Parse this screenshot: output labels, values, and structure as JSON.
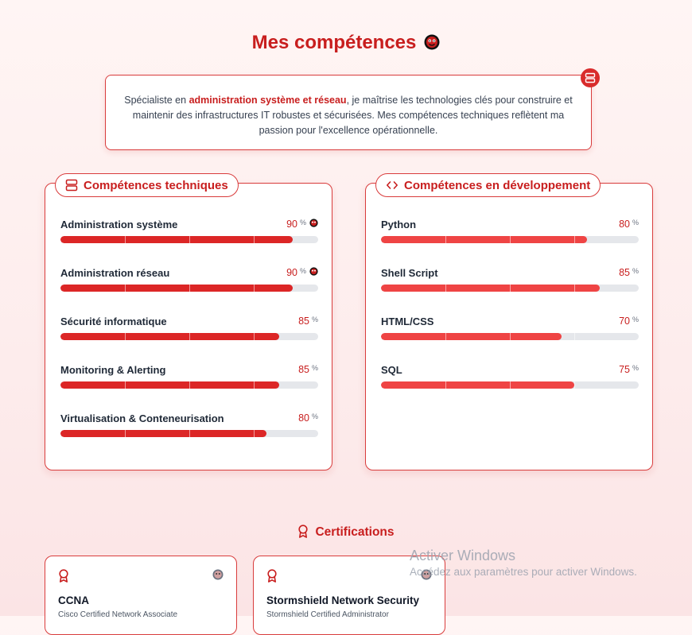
{
  "header": {
    "title": "Mes compétences",
    "emoji_icon": "smiley-icon"
  },
  "intro": {
    "text_before": "Spécialiste en ",
    "highlight": "administration système et réseau",
    "text_after": ", je maîtrise les technologies clés pour construire et maintenir des infrastructures IT robustes et sécurisées. Mes compétences techniques reflètent ma passion pour l'excellence opérationnelle.",
    "badge_icon": "server-icon"
  },
  "technical": {
    "title": "Compétences techniques",
    "icon": "server-icon",
    "skills": [
      {
        "name": "Administration système",
        "value": 90,
        "unit": "%",
        "emoji": true
      },
      {
        "name": "Administration réseau",
        "value": 90,
        "unit": "%",
        "emoji": true
      },
      {
        "name": "Sécurité informatique",
        "value": 85,
        "unit": "%",
        "emoji": false
      },
      {
        "name": "Monitoring & Alerting",
        "value": 85,
        "unit": "%",
        "emoji": false
      },
      {
        "name": "Virtualisation & Conteneurisation",
        "value": 80,
        "unit": "%",
        "emoji": false
      }
    ]
  },
  "development": {
    "title": "Compétences en développement",
    "icon": "code-icon",
    "skills": [
      {
        "name": "Python",
        "value": 80,
        "unit": "%"
      },
      {
        "name": "Shell Script",
        "value": 85,
        "unit": "%"
      },
      {
        "name": "HTML/CSS",
        "value": 70,
        "unit": "%"
      },
      {
        "name": "SQL",
        "value": 75,
        "unit": "%"
      }
    ]
  },
  "certifications": {
    "title": "Certifications",
    "icon": "award-icon",
    "items": [
      {
        "name": "CCNA",
        "issuer": "Cisco Certified Network Associate"
      },
      {
        "name": "Stormshield Network Security",
        "issuer": "Stormshield Certified Administrator"
      }
    ]
  },
  "watermark": {
    "line1": "Activer Windows",
    "line2": "Accédez aux paramètres pour activer Windows."
  },
  "colors": {
    "accent": "#c81e1e",
    "bar_technical": "#dc2626",
    "bar_development": "#ef4444",
    "track": "#e5e7eb"
  }
}
